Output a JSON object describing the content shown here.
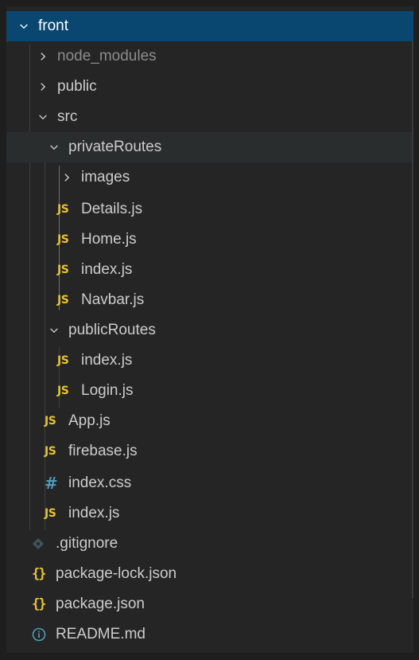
{
  "explorer": {
    "root": {
      "label": "front"
    },
    "items": [
      {
        "label": "node_modules",
        "kind": "folder",
        "expanded": false,
        "icon": "chevron-right-icon"
      },
      {
        "label": "public",
        "kind": "folder",
        "expanded": false,
        "icon": "chevron-right-icon"
      },
      {
        "label": "src",
        "kind": "folder",
        "expanded": true,
        "icon": "chevron-down-icon"
      },
      {
        "label": "privateRoutes",
        "kind": "folder",
        "expanded": true,
        "icon": "chevron-down-icon"
      },
      {
        "label": "images",
        "kind": "folder",
        "expanded": false,
        "icon": "chevron-right-icon"
      },
      {
        "label": "Details.js",
        "kind": "file",
        "icon": "js-file-icon",
        "badge": "JS"
      },
      {
        "label": "Home.js",
        "kind": "file",
        "icon": "js-file-icon",
        "badge": "JS"
      },
      {
        "label": "index.js",
        "kind": "file",
        "icon": "js-file-icon",
        "badge": "JS"
      },
      {
        "label": "Navbar.js",
        "kind": "file",
        "icon": "js-file-icon",
        "badge": "JS"
      },
      {
        "label": "publicRoutes",
        "kind": "folder",
        "expanded": true,
        "icon": "chevron-down-icon"
      },
      {
        "label": "index.js",
        "kind": "file",
        "icon": "js-file-icon",
        "badge": "JS"
      },
      {
        "label": "Login.js",
        "kind": "file",
        "icon": "js-file-icon",
        "badge": "JS"
      },
      {
        "label": "App.js",
        "kind": "file",
        "icon": "js-file-icon",
        "badge": "JS"
      },
      {
        "label": "firebase.js",
        "kind": "file",
        "icon": "js-file-icon",
        "badge": "JS"
      },
      {
        "label": "index.css",
        "kind": "file",
        "icon": "css-file-icon",
        "badge": "#"
      },
      {
        "label": "index.js",
        "kind": "file",
        "icon": "js-file-icon",
        "badge": "JS"
      },
      {
        "label": ".gitignore",
        "kind": "file",
        "icon": "git-file-icon"
      },
      {
        "label": "package-lock.json",
        "kind": "file",
        "icon": "json-file-icon",
        "badge": "{}"
      },
      {
        "label": "package.json",
        "kind": "file",
        "icon": "json-file-icon",
        "badge": "{}"
      },
      {
        "label": "README.md",
        "kind": "file",
        "icon": "info-file-icon"
      }
    ]
  },
  "colors": {
    "selection": "#094771",
    "background": "#252526",
    "js": "#e8c32f",
    "css": "#519aba",
    "info": "#519aba"
  }
}
